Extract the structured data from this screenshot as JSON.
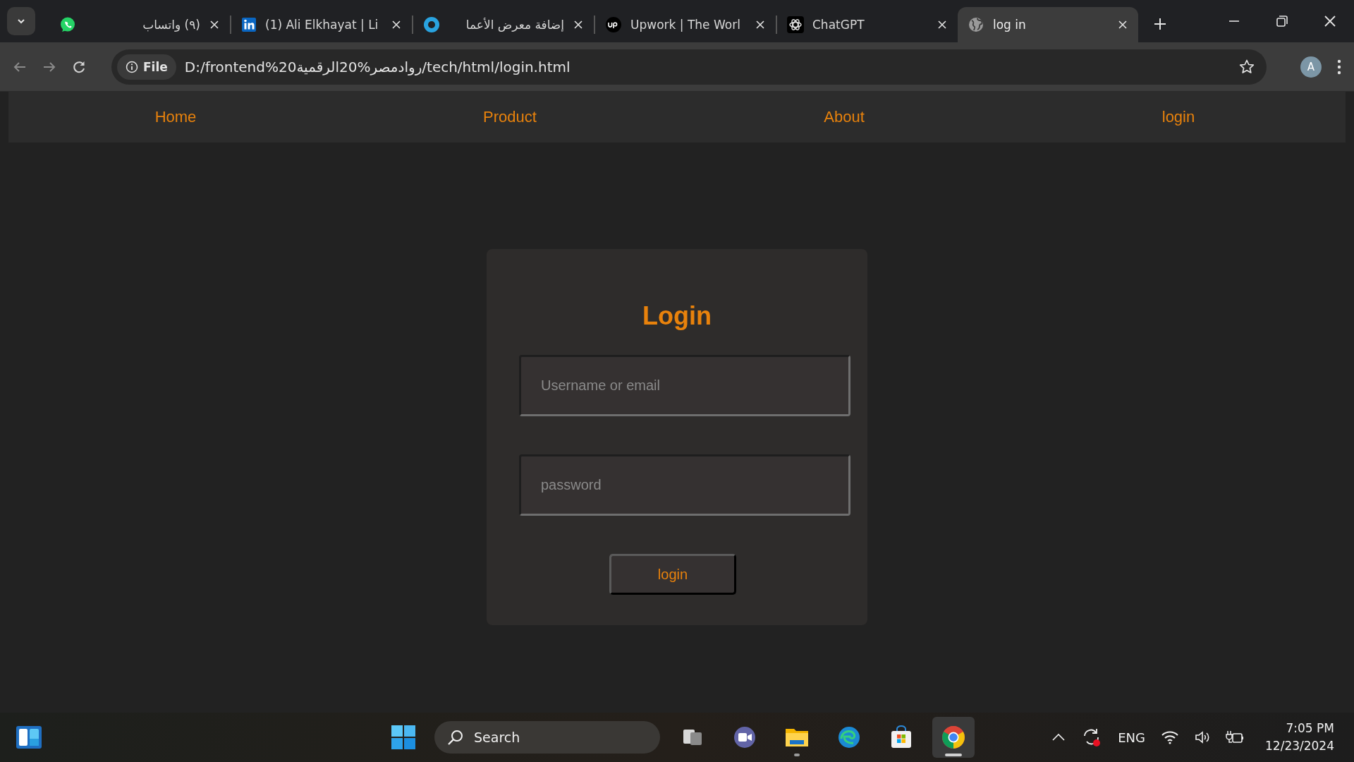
{
  "browser": {
    "tabs": [
      {
        "title": "(٩) واتساب",
        "selected": false
      },
      {
        "title": "(1) Ali Elkhayat | Li",
        "selected": false
      },
      {
        "title": "إضافة معرض الأعما",
        "selected": false
      },
      {
        "title": "Upwork | The Worl",
        "selected": false
      },
      {
        "title": "ChatGPT",
        "selected": false
      },
      {
        "title": "log in",
        "selected": true
      }
    ],
    "address": {
      "badge": "File",
      "url": "D:/frontend%20روادمصر%20الرقمية/tech/html/login.html"
    },
    "profile": "A"
  },
  "nav": {
    "links": [
      "Home",
      "Product",
      "About",
      "login"
    ]
  },
  "login": {
    "title": "Login",
    "username_field": {
      "placeholder": "Username or email"
    },
    "password_field": {
      "placeholder": "password"
    },
    "button": "login"
  },
  "taskbar": {
    "search": {
      "placeholder": "Search"
    },
    "apps": [
      {
        "running": false,
        "selected": false
      },
      {
        "running": false,
        "selected": false
      },
      {
        "running": true,
        "selected": false
      },
      {
        "running": false,
        "selected": false
      },
      {
        "running": false,
        "selected": false
      },
      {
        "running": true,
        "selected": true
      }
    ],
    "language": "ENG",
    "time": "7:05 PM",
    "date": "12/23/2024"
  }
}
